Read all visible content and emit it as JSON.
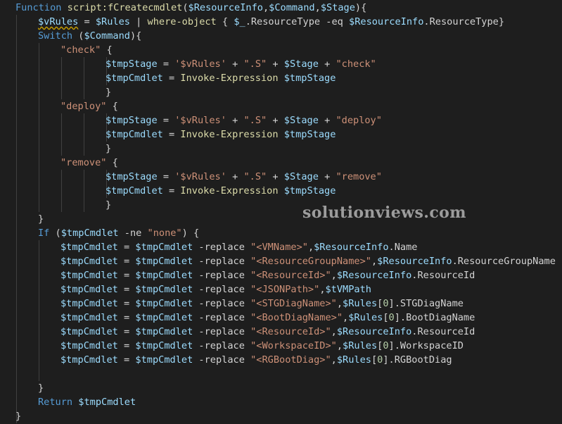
{
  "colors": {
    "background": "#1e1e1e",
    "keyword": "#569cd6",
    "variable": "#9cdcfe",
    "function": "#dcdcaa",
    "string": "#ce9178",
    "number": "#b5cea8",
    "plain": "#d4d4d4",
    "indent_guide": "#404040",
    "warning_squiggle": "#c9a000",
    "watermark": "#b3b3b3"
  },
  "watermark": "solutionviews.com",
  "code": {
    "lines": [
      {
        "indent": 0,
        "tokens": [
          [
            "kw",
            "Function"
          ],
          [
            "op",
            " "
          ],
          [
            "fn",
            "script:fCreatecmdlet"
          ],
          [
            "op",
            "("
          ],
          [
            "var",
            "$ResourceInfo"
          ],
          [
            "op",
            ","
          ],
          [
            "var",
            "$Command"
          ],
          [
            "op",
            ","
          ],
          [
            "var",
            "$Stage"
          ],
          [
            "op",
            "){"
          ]
        ]
      },
      {
        "indent": 1,
        "tokens": [
          [
            "squig",
            "$vRules"
          ],
          [
            "op",
            " = "
          ],
          [
            "var",
            "$Rules"
          ],
          [
            "op",
            " | "
          ],
          [
            "fn",
            "where-object"
          ],
          [
            "op",
            " { "
          ],
          [
            "var",
            "$_"
          ],
          [
            "op",
            "."
          ],
          [
            "prop",
            "ResourceType"
          ],
          [
            "op",
            " -eq "
          ],
          [
            "var",
            "$ResourceInfo"
          ],
          [
            "op",
            "."
          ],
          [
            "prop",
            "ResourceType"
          ],
          [
            "op",
            "}"
          ]
        ]
      },
      {
        "indent": 1,
        "tokens": [
          [
            "kw",
            "Switch"
          ],
          [
            "op",
            " ("
          ],
          [
            "var",
            "$Command"
          ],
          [
            "op",
            "){"
          ]
        ]
      },
      {
        "indent": 2,
        "tokens": [
          [
            "str",
            "\"check\""
          ],
          [
            "op",
            " {"
          ]
        ]
      },
      {
        "indent": 4,
        "tokens": [
          [
            "var",
            "$tmpStage"
          ],
          [
            "op",
            " = "
          ],
          [
            "str",
            "'$vRules'"
          ],
          [
            "op",
            " + "
          ],
          [
            "str",
            "\".S\""
          ],
          [
            "op",
            " + "
          ],
          [
            "var",
            "$Stage"
          ],
          [
            "op",
            " + "
          ],
          [
            "str",
            "\"check\""
          ]
        ]
      },
      {
        "indent": 4,
        "tokens": [
          [
            "var",
            "$tmpCmdlet"
          ],
          [
            "op",
            " = "
          ],
          [
            "fn",
            "Invoke-Expression"
          ],
          [
            "op",
            " "
          ],
          [
            "var",
            "$tmpStage"
          ]
        ]
      },
      {
        "indent": 4,
        "tokens": [
          [
            "op",
            "}"
          ]
        ]
      },
      {
        "indent": 2,
        "tokens": [
          [
            "str",
            "\"deploy\""
          ],
          [
            "op",
            " {"
          ]
        ]
      },
      {
        "indent": 4,
        "tokens": [
          [
            "var",
            "$tmpStage"
          ],
          [
            "op",
            " = "
          ],
          [
            "str",
            "'$vRules'"
          ],
          [
            "op",
            " + "
          ],
          [
            "str",
            "\".S\""
          ],
          [
            "op",
            " + "
          ],
          [
            "var",
            "$Stage"
          ],
          [
            "op",
            " + "
          ],
          [
            "str",
            "\"deploy\""
          ]
        ]
      },
      {
        "indent": 4,
        "tokens": [
          [
            "var",
            "$tmpCmdlet"
          ],
          [
            "op",
            " = "
          ],
          [
            "fn",
            "Invoke-Expression"
          ],
          [
            "op",
            " "
          ],
          [
            "var",
            "$tmpStage"
          ]
        ]
      },
      {
        "indent": 4,
        "tokens": [
          [
            "op",
            "}"
          ]
        ]
      },
      {
        "indent": 2,
        "tokens": [
          [
            "str",
            "\"remove\""
          ],
          [
            "op",
            " {"
          ]
        ]
      },
      {
        "indent": 4,
        "tokens": [
          [
            "var",
            "$tmpStage"
          ],
          [
            "op",
            " = "
          ],
          [
            "str",
            "'$vRules'"
          ],
          [
            "op",
            " + "
          ],
          [
            "str",
            "\".S\""
          ],
          [
            "op",
            " + "
          ],
          [
            "var",
            "$Stage"
          ],
          [
            "op",
            " + "
          ],
          [
            "str",
            "\"remove\""
          ]
        ]
      },
      {
        "indent": 4,
        "tokens": [
          [
            "var",
            "$tmpCmdlet"
          ],
          [
            "op",
            " = "
          ],
          [
            "fn",
            "Invoke-Expression"
          ],
          [
            "op",
            " "
          ],
          [
            "var",
            "$tmpStage"
          ]
        ]
      },
      {
        "indent": 4,
        "tokens": [
          [
            "op",
            "}"
          ]
        ]
      },
      {
        "indent": 1,
        "tokens": [
          [
            "op",
            "}"
          ]
        ]
      },
      {
        "indent": 1,
        "tokens": [
          [
            "kw",
            "If"
          ],
          [
            "op",
            " ("
          ],
          [
            "var",
            "$tmpCmdlet"
          ],
          [
            "op",
            " -ne "
          ],
          [
            "str",
            "\"none\""
          ],
          [
            "op",
            ") {"
          ]
        ]
      },
      {
        "indent": 2,
        "tokens": [
          [
            "var",
            "$tmpCmdlet"
          ],
          [
            "op",
            " = "
          ],
          [
            "var",
            "$tmpCmdlet"
          ],
          [
            "op",
            " -replace "
          ],
          [
            "str",
            "\"<VMName>\""
          ],
          [
            "op",
            ","
          ],
          [
            "var",
            "$ResourceInfo"
          ],
          [
            "op",
            "."
          ],
          [
            "prop",
            "Name"
          ]
        ]
      },
      {
        "indent": 2,
        "tokens": [
          [
            "var",
            "$tmpCmdlet"
          ],
          [
            "op",
            " = "
          ],
          [
            "var",
            "$tmpCmdlet"
          ],
          [
            "op",
            " -replace "
          ],
          [
            "str",
            "\"<ResourceGroupName>\""
          ],
          [
            "op",
            ","
          ],
          [
            "var",
            "$ResourceInfo"
          ],
          [
            "op",
            "."
          ],
          [
            "prop",
            "ResourceGroupName"
          ]
        ]
      },
      {
        "indent": 2,
        "tokens": [
          [
            "var",
            "$tmpCmdlet"
          ],
          [
            "op",
            " = "
          ],
          [
            "var",
            "$tmpCmdlet"
          ],
          [
            "op",
            " -replace "
          ],
          [
            "str",
            "\"<ResourceId>\""
          ],
          [
            "op",
            ","
          ],
          [
            "var",
            "$ResourceInfo"
          ],
          [
            "op",
            "."
          ],
          [
            "prop",
            "ResourceId"
          ]
        ]
      },
      {
        "indent": 2,
        "tokens": [
          [
            "var",
            "$tmpCmdlet"
          ],
          [
            "op",
            " = "
          ],
          [
            "var",
            "$tmpCmdlet"
          ],
          [
            "op",
            " -replace "
          ],
          [
            "str",
            "\"<JSONPath>\""
          ],
          [
            "op",
            ","
          ],
          [
            "var",
            "$tVMPath"
          ]
        ]
      },
      {
        "indent": 2,
        "tokens": [
          [
            "var",
            "$tmpCmdlet"
          ],
          [
            "op",
            " = "
          ],
          [
            "var",
            "$tmpCmdlet"
          ],
          [
            "op",
            " -replace "
          ],
          [
            "str",
            "\"<STGDiagName>\""
          ],
          [
            "op",
            ","
          ],
          [
            "var",
            "$Rules"
          ],
          [
            "op",
            "["
          ],
          [
            "num",
            "0"
          ],
          [
            "op",
            "]."
          ],
          [
            "prop",
            "STGDiagName"
          ]
        ]
      },
      {
        "indent": 2,
        "tokens": [
          [
            "var",
            "$tmpCmdlet"
          ],
          [
            "op",
            " = "
          ],
          [
            "var",
            "$tmpCmdlet"
          ],
          [
            "op",
            " -replace "
          ],
          [
            "str",
            "\"<BootDiagName>\""
          ],
          [
            "op",
            ","
          ],
          [
            "var",
            "$Rules"
          ],
          [
            "op",
            "["
          ],
          [
            "num",
            "0"
          ],
          [
            "op",
            "]."
          ],
          [
            "prop",
            "BootDiagName"
          ]
        ]
      },
      {
        "indent": 2,
        "tokens": [
          [
            "var",
            "$tmpCmdlet"
          ],
          [
            "op",
            " = "
          ],
          [
            "var",
            "$tmpCmdlet"
          ],
          [
            "op",
            " -replace "
          ],
          [
            "str",
            "\"<ResourceId>\""
          ],
          [
            "op",
            ","
          ],
          [
            "var",
            "$ResourceInfo"
          ],
          [
            "op",
            "."
          ],
          [
            "prop",
            "ResourceId"
          ]
        ]
      },
      {
        "indent": 2,
        "tokens": [
          [
            "var",
            "$tmpCmdlet"
          ],
          [
            "op",
            " = "
          ],
          [
            "var",
            "$tmpCmdlet"
          ],
          [
            "op",
            " -replace "
          ],
          [
            "str",
            "\"<WorkspaceID>\""
          ],
          [
            "op",
            ","
          ],
          [
            "var",
            "$Rules"
          ],
          [
            "op",
            "["
          ],
          [
            "num",
            "0"
          ],
          [
            "op",
            "]."
          ],
          [
            "prop",
            "WorkspaceID"
          ]
        ]
      },
      {
        "indent": 2,
        "tokens": [
          [
            "var",
            "$tmpCmdlet"
          ],
          [
            "op",
            " = "
          ],
          [
            "var",
            "$tmpCmdlet"
          ],
          [
            "op",
            " -replace "
          ],
          [
            "str",
            "\"<RGBootDiag>\""
          ],
          [
            "op",
            ","
          ],
          [
            "var",
            "$Rules"
          ],
          [
            "op",
            "["
          ],
          [
            "num",
            "0"
          ],
          [
            "op",
            "]."
          ],
          [
            "prop",
            "RGBootDiag"
          ]
        ]
      },
      {
        "indent": 0,
        "tokens": []
      },
      {
        "indent": 1,
        "tokens": [
          [
            "op",
            "}"
          ]
        ]
      },
      {
        "indent": 1,
        "tokens": [
          [
            "kw",
            "Return"
          ],
          [
            "op",
            " "
          ],
          [
            "var",
            "$tmpCmdlet"
          ]
        ]
      },
      {
        "indent": 0,
        "tokens": [
          [
            "op",
            "}"
          ]
        ]
      }
    ]
  }
}
